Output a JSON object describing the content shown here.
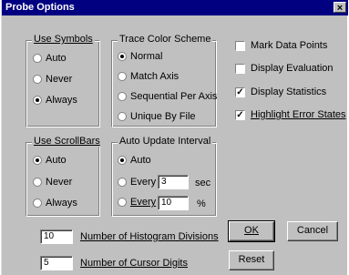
{
  "window": {
    "title": "Probe Options",
    "close_glyph": "×"
  },
  "use_symbols": {
    "legend": "Use Symbols",
    "options": [
      {
        "label": "Auto",
        "selected": false
      },
      {
        "label": "Never",
        "selected": false
      },
      {
        "label": "Always",
        "selected": true
      }
    ]
  },
  "trace_color_scheme": {
    "legend": "Trace Color Scheme",
    "options": [
      {
        "label": "Normal",
        "selected": true
      },
      {
        "label": "Match Axis",
        "selected": false
      },
      {
        "label": "Sequential Per Axis",
        "selected": false
      },
      {
        "label": "Unique By File",
        "selected": false
      }
    ]
  },
  "checkboxes": [
    {
      "label": "Mark Data Points",
      "checked": false
    },
    {
      "label": "Display Evaluation",
      "checked": false
    },
    {
      "label": "Display Statistics",
      "checked": true
    },
    {
      "label": "Highlight Error States",
      "checked": true
    }
  ],
  "use_scrollbars": {
    "legend": "Use ScrollBars",
    "options": [
      {
        "label": "Auto",
        "selected": true
      },
      {
        "label": "Never",
        "selected": false
      },
      {
        "label": "Always",
        "selected": false
      }
    ]
  },
  "auto_update_interval": {
    "legend": "Auto Update Interval",
    "auto_label": "Auto",
    "every_label": "Every",
    "sec_value": "3",
    "sec_unit": "sec",
    "pct_value": "10",
    "pct_unit": "%"
  },
  "histogram": {
    "value": "10",
    "label": "Number of Histogram Divisions"
  },
  "cursor_digits": {
    "value": "5",
    "label": "Number of Cursor Digits"
  },
  "buttons": {
    "ok": "OK",
    "cancel": "Cancel",
    "reset": "Reset"
  }
}
